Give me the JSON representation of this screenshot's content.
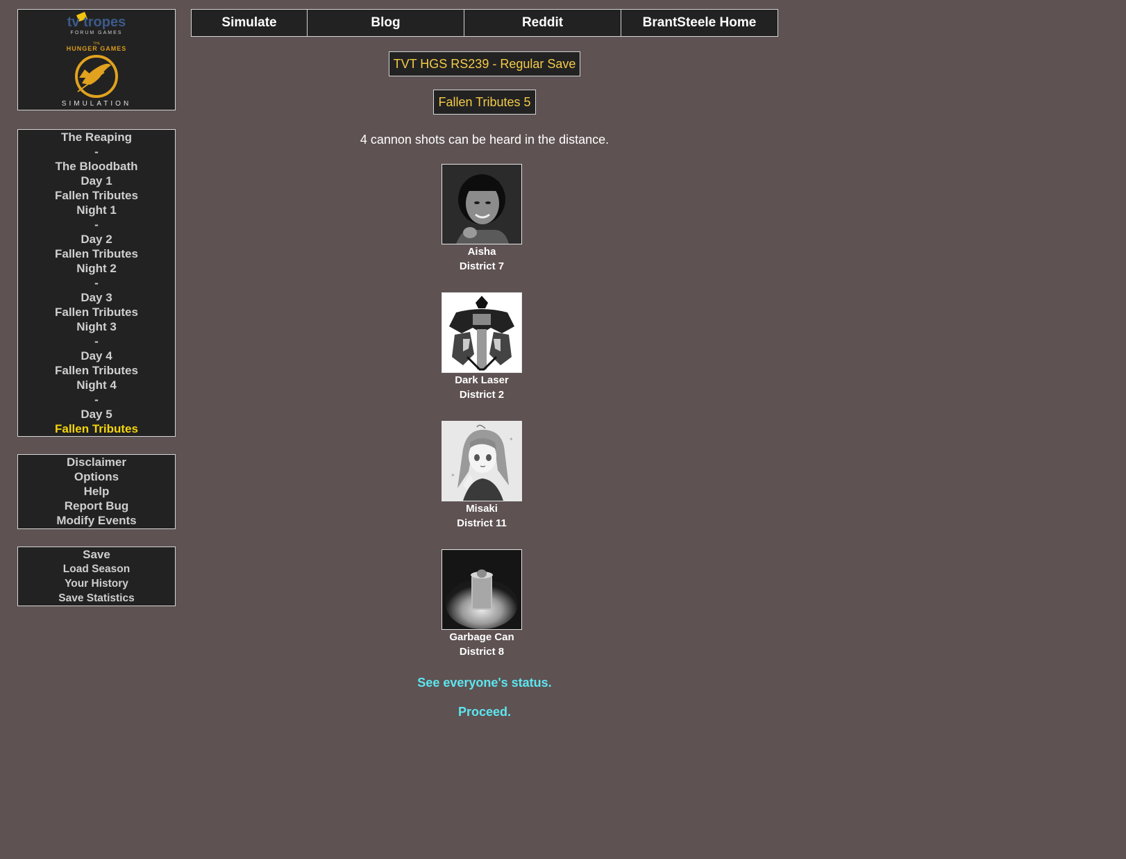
{
  "logo": {
    "brand": "tv tropes",
    "sub": "FORUM GAMES",
    "the": "THE",
    "title": "HUNGER GAMES",
    "footer": "SIMULATION"
  },
  "sidebar": {
    "nav": [
      {
        "label": "The Reaping"
      },
      {
        "label": "-"
      },
      {
        "label": "The Bloodbath"
      },
      {
        "label": "Day 1"
      },
      {
        "label": "Fallen Tributes"
      },
      {
        "label": "Night 1"
      },
      {
        "label": "-"
      },
      {
        "label": "Day 2"
      },
      {
        "label": "Fallen Tributes"
      },
      {
        "label": "Night 2"
      },
      {
        "label": "-"
      },
      {
        "label": "Day 3"
      },
      {
        "label": "Fallen Tributes"
      },
      {
        "label": "Night 3"
      },
      {
        "label": "-"
      },
      {
        "label": "Day 4"
      },
      {
        "label": "Fallen Tributes"
      },
      {
        "label": "Night 4"
      },
      {
        "label": "-"
      },
      {
        "label": "Day 5"
      },
      {
        "label": "Fallen Tributes"
      }
    ],
    "info": [
      {
        "label": "Disclaimer"
      },
      {
        "label": "Options"
      },
      {
        "label": "Help"
      },
      {
        "label": "Report Bug"
      },
      {
        "label": "Modify Events"
      }
    ],
    "save": [
      {
        "label": "Save"
      },
      {
        "label": "Load Season"
      },
      {
        "label": "Your History"
      },
      {
        "label": "Save Statistics"
      }
    ]
  },
  "topnav": [
    {
      "label": "Simulate"
    },
    {
      "label": "Blog"
    },
    {
      "label": "Reddit"
    },
    {
      "label": "BrantSteele Home"
    }
  ],
  "main": {
    "save_title": "TVT HGS RS239 - Regular Save",
    "page_title": "Fallen Tributes 5",
    "cannon_text": "4 cannon shots can be heard in the distance.",
    "tributes": [
      {
        "name": "Aisha",
        "district": "District 7",
        "icon": "portrait-photo"
      },
      {
        "name": "Dark Laser",
        "district": "District 2",
        "icon": "robot-drawing"
      },
      {
        "name": "Misaki",
        "district": "District 11",
        "icon": "anime-girl"
      },
      {
        "name": "Garbage Can",
        "district": "District 8",
        "icon": "garbage-can-photo"
      }
    ],
    "status_link": "See everyone's status.",
    "proceed_link": "Proceed."
  },
  "colors": {
    "background": "#5e5252",
    "panel": "#222222",
    "active_nav": "#f4d50a",
    "tag_text": "#f4cb48",
    "action_link": "#5de6f0"
  }
}
